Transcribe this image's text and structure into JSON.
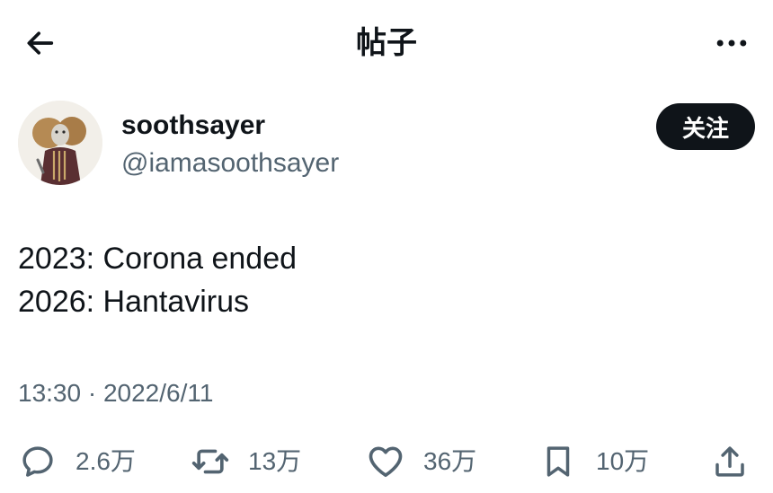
{
  "header": {
    "title": "帖子",
    "back_icon": "arrow-left-icon",
    "more_icon": "more-horizontal-icon"
  },
  "author": {
    "display_name": "soothsayer",
    "handle": "@iamasoothsayer",
    "follow_label": "关注"
  },
  "tweet": {
    "lines": [
      "2023: Corona ended",
      "2026: Hantavirus"
    ]
  },
  "meta": {
    "timestamp": "13:30 · 2022/6/11"
  },
  "actions": {
    "reply": {
      "icon": "reply-icon",
      "count": "2.6万"
    },
    "retweet": {
      "icon": "retweet-icon",
      "count": "13万"
    },
    "like": {
      "icon": "heart-icon",
      "count": "36万"
    },
    "bookmark": {
      "icon": "bookmark-icon",
      "count": "10万"
    },
    "share": {
      "icon": "share-icon"
    }
  },
  "colors": {
    "text": "#0f1419",
    "secondary": "#536471",
    "follow_bg": "#0f1419",
    "background": "#ffffff"
  }
}
